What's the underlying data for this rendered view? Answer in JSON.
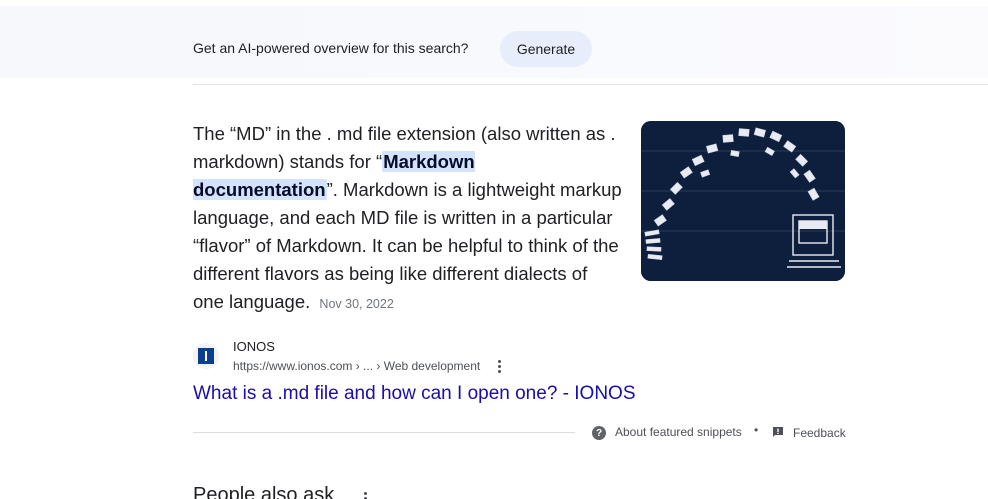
{
  "ai_overview": {
    "prompt": "Get an AI-powered overview for this search?",
    "button_label": "Generate"
  },
  "snippet": {
    "text_before": "The “MD” in the . md file extension (also written as . markdown) stands for “",
    "highlight": "Markdown documentation",
    "text_after": "”. Markdown is a lightweight markup language, and each MD file is written in a particular “flavor” of Markdown. It can be helpful to think of the different flavors as being like different dialects of one language.",
    "date": "Nov 30, 2022"
  },
  "source": {
    "name": "IONOS",
    "url": "https://www.ionos.com › ... › Web development",
    "favicon": "ionos-favicon"
  },
  "result": {
    "title": "What is a .md file and how can I open one? - IONOS"
  },
  "footer": {
    "about_label": "About featured snippets",
    "separator": "•",
    "feedback_label": "Feedback"
  },
  "people_also_ask": {
    "heading": "People also ask"
  },
  "colors": {
    "link": "#1a0dab",
    "highlight_bg": "#d3e3fd",
    "generate_bg": "#e8edfb",
    "thumb_bg": "#0e1f3d"
  }
}
